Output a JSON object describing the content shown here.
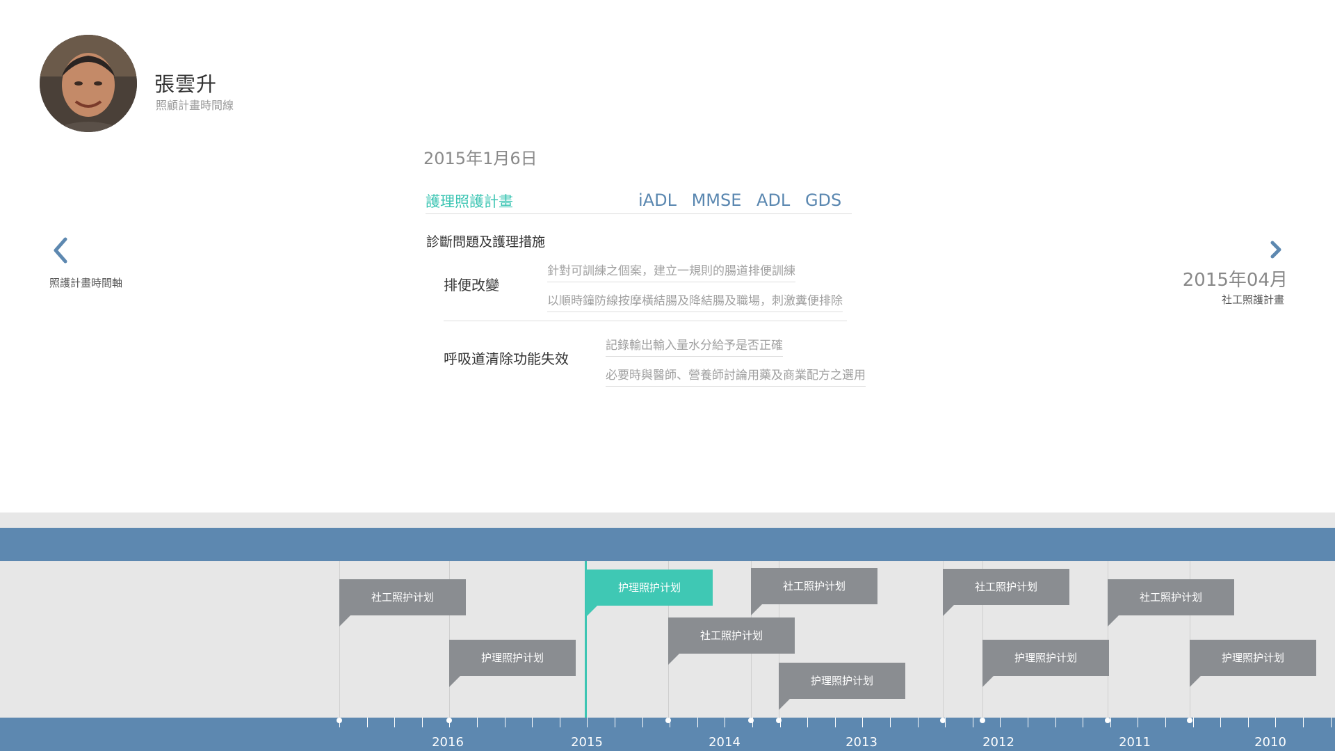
{
  "patient": {
    "name": "張雲升",
    "subtitle": "照顧計畫時間線"
  },
  "nav": {
    "prev_label": "照護計畫時間軸",
    "next_title": "2015年04月",
    "next_subtitle": "社工照護計畫",
    "prev_icon": "chevron-left-icon",
    "next_icon": "chevron-right-icon"
  },
  "plan": {
    "date": "2015年1月6日",
    "active_tab": "護理照護計畫",
    "assessments": [
      "iADL",
      "MMSE",
      "ADL",
      "GDS"
    ],
    "section_title": "診斷問題及護理措施",
    "problems": [
      {
        "label": "排便改變",
        "measures": [
          "針對可訓練之個案，建立一規則的腸道排便訓練",
          "以順時鐘防線按摩橫結腸及降結腸及職場，刺激糞便排除"
        ]
      },
      {
        "label": "呼吸道清除功能失效",
        "measures": [
          "記錄輸出輸入量水分給予是否正確",
          "必要時與醫師、營養師討論用藥及商業配方之選用"
        ]
      }
    ]
  },
  "timeline": {
    "years": [
      "2016",
      "2015",
      "2014",
      "2013",
      "2012",
      "2011",
      "2010"
    ],
    "events": [
      {
        "label": "社工照护计划",
        "active": false
      },
      {
        "label": "护理照护计划",
        "active": false
      },
      {
        "label": "护理照护计划",
        "active": true
      },
      {
        "label": "社工照护计划",
        "active": false
      },
      {
        "label": "社工照护计划",
        "active": false
      },
      {
        "label": "护理照护计划",
        "active": false
      },
      {
        "label": "社工照护计划",
        "active": false
      },
      {
        "label": "护理照护计划",
        "active": false
      },
      {
        "label": "社工照护计划",
        "active": false
      },
      {
        "label": "护理照护计划",
        "active": false
      }
    ],
    "colors": {
      "bar": "#5d88b0",
      "active": "#3fc8b4",
      "inactive": "#8a8d91"
    }
  }
}
